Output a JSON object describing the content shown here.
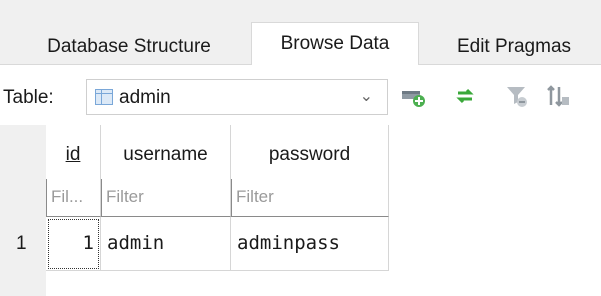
{
  "tabs": [
    {
      "label": "Database Structure"
    },
    {
      "label": "Browse Data"
    },
    {
      "label": "Edit Pragmas"
    }
  ],
  "active_tab": "Browse Data",
  "toolbar": {
    "table_label": "Table:",
    "table_selected": "admin",
    "buttons": [
      "new-record-icon",
      "refresh-icon",
      "clear-filters-icon",
      "sort-icon"
    ]
  },
  "grid": {
    "columns": [
      "id",
      "username",
      "password"
    ],
    "filters": [
      "Fil...",
      "Filter",
      "Filter"
    ],
    "rows": [
      {
        "rownum": "1",
        "cells": [
          "1",
          "admin",
          "adminpass"
        ]
      }
    ]
  }
}
